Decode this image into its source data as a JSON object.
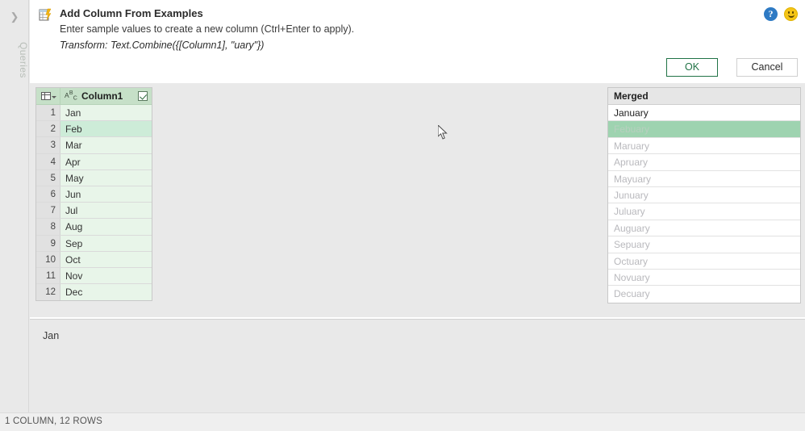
{
  "rail": {
    "expand_icon": "chevron-right-icon",
    "label": "Queries"
  },
  "header": {
    "icon": "add-column-from-examples-icon",
    "title": "Add Column From Examples",
    "subtitle": "Enter sample values to create a new column (Ctrl+Enter to apply).",
    "transform": "Transform: Text.Combine({[Column1], \"uary\"})",
    "help_icon": "help-icon",
    "feedback_icon": "smiley-feedback-icon"
  },
  "buttons": {
    "ok": "OK",
    "cancel": "Cancel"
  },
  "source_table": {
    "corner_icon": "select-all-grid-icon",
    "type_icon": "abc-text-type-icon",
    "column_header": "Column1",
    "checkbox_checked": true,
    "selected_row_index": 1,
    "rows": [
      {
        "num": "1",
        "value": "Jan"
      },
      {
        "num": "2",
        "value": "Feb"
      },
      {
        "num": "3",
        "value": "Mar"
      },
      {
        "num": "4",
        "value": "Apr"
      },
      {
        "num": "5",
        "value": "May"
      },
      {
        "num": "6",
        "value": "Jun"
      },
      {
        "num": "7",
        "value": "Jul"
      },
      {
        "num": "8",
        "value": "Aug"
      },
      {
        "num": "9",
        "value": "Sep"
      },
      {
        "num": "10",
        "value": "Oct"
      },
      {
        "num": "11",
        "value": "Nov"
      },
      {
        "num": "12",
        "value": "Dec"
      }
    ]
  },
  "merged_panel": {
    "header": "Merged",
    "selected_row_index": 1,
    "rows": [
      {
        "value": "January",
        "state": "confirmed"
      },
      {
        "value": "Febuary",
        "state": "selected"
      },
      {
        "value": "Maruary",
        "state": "suggested"
      },
      {
        "value": "Apruary",
        "state": "suggested"
      },
      {
        "value": "Mayuary",
        "state": "suggested"
      },
      {
        "value": "Junuary",
        "state": "suggested"
      },
      {
        "value": "Juluary",
        "state": "suggested"
      },
      {
        "value": "Auguary",
        "state": "suggested"
      },
      {
        "value": "Sepuary",
        "state": "suggested"
      },
      {
        "value": "Octuary",
        "state": "suggested"
      },
      {
        "value": "Novuary",
        "state": "suggested"
      },
      {
        "value": "Decuary",
        "state": "suggested"
      }
    ]
  },
  "preview": {
    "text": "Jan"
  },
  "statusbar": {
    "text": "1 COLUMN, 12 ROWS"
  },
  "colors": {
    "accent_green": "#217346",
    "header_green": "#c6e0c8",
    "cell_green": "#e8f5e9",
    "selected_row_green": "#cdecd8",
    "merged_selected_green": "#9ed3b0",
    "help_blue": "#2e7ac4",
    "smiley_yellow": "#f5c518"
  }
}
